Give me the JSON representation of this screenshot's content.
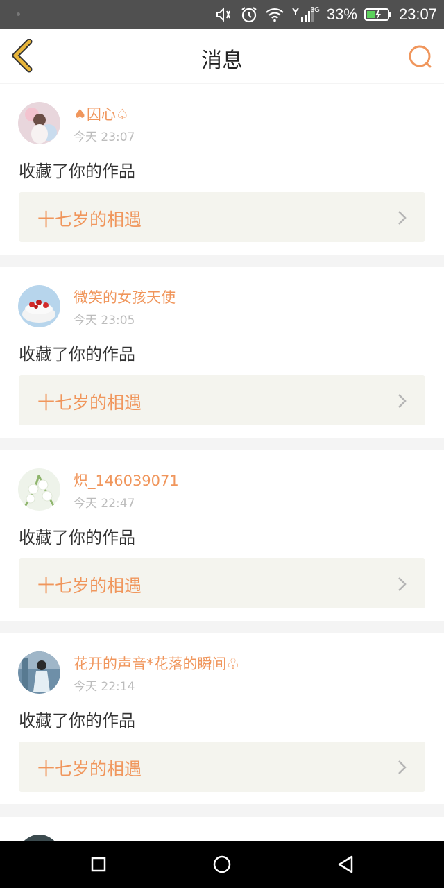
{
  "status_bar": {
    "battery": "33%",
    "time": "23:07",
    "network": "3G"
  },
  "header": {
    "title": "消息"
  },
  "messages": [
    {
      "name": "♠囚心♤",
      "time": "今天 23:07",
      "action": "收藏了你的作品",
      "work_title": "十七岁的相遇"
    },
    {
      "name": "微笑的女孩天使",
      "time": "今天 23:05",
      "action": "收藏了你的作品",
      "work_title": "十七岁的相遇"
    },
    {
      "name": "炽_146039071",
      "time": "今天 22:47",
      "action": "收藏了你的作品",
      "work_title": "十七岁的相遇"
    },
    {
      "name": "花开的声音*花落的瞬间♧",
      "time": "今天 22:14",
      "action": "收藏了你的作品",
      "work_title": "十七岁的相遇"
    }
  ],
  "colors": {
    "accent": "#f0965c",
    "back_arrow": "#e8b53a"
  }
}
